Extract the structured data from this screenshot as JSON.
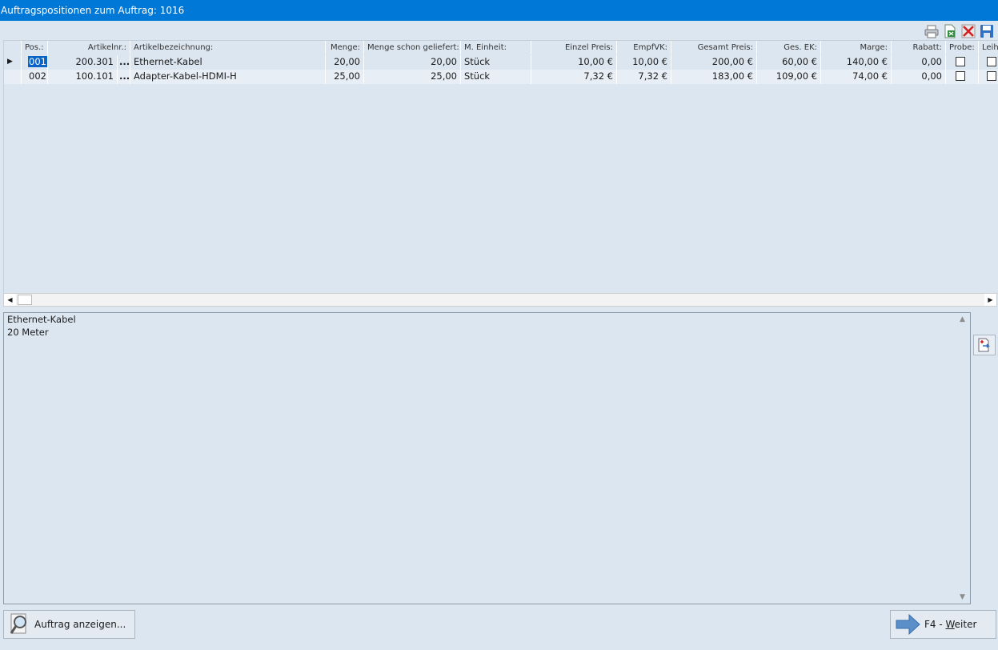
{
  "window": {
    "title": "Auftragspositionen zum Auftrag: 1016"
  },
  "toolbar": [
    {
      "icon": "printer-icon"
    },
    {
      "icon": "excel-export-icon"
    },
    {
      "icon": "delete-icon"
    },
    {
      "icon": "save-icon"
    }
  ],
  "grid": {
    "headers": {
      "pos": "Pos.:",
      "artikelnr": "Artikelnr.:",
      "bezeichnung": "Artikelbezeichnung:",
      "menge": "Menge:",
      "geliefert": "Menge schon geliefert:",
      "einheit": "M. Einheit:",
      "einzelpreis": "Einzel Preis:",
      "empfvk": "EmpfVK:",
      "gesamtpreis": "Gesamt Preis:",
      "gesek": "Ges. EK:",
      "marge": "Marge:",
      "rabatt": "Rabatt:",
      "probe": "Probe:",
      "leih": "Leih"
    },
    "rows": [
      {
        "pos": "001",
        "artikelnr": "200.301",
        "dots": "...",
        "bezeichnung": "Ethernet-Kabel",
        "menge": "20,00",
        "geliefert": "20,00",
        "einheit": "Stück",
        "einzelpreis": "10,00 €",
        "empfvk": "10,00 €",
        "gesamtpreis": "200,00 €",
        "gesek": "60,00 €",
        "marge": "140,00 €",
        "rabatt": "0,00"
      },
      {
        "pos": "002",
        "artikelnr": "100.101",
        "dots": "...",
        "bezeichnung": "Adapter-Kabel-HDMI-H",
        "menge": "25,00",
        "geliefert": "25,00",
        "einheit": "Stück",
        "einzelpreis": "7,32 €",
        "empfvk": "7,32 €",
        "gesamtpreis": "183,00 €",
        "gesek": "109,00 €",
        "marge": "74,00 €",
        "rabatt": "0,00"
      }
    ]
  },
  "memo": {
    "text": "Ethernet-Kabel\n20 Meter"
  },
  "buttons": {
    "show_order": "Auftrag anzeigen...",
    "next_prefix": "F4 - ",
    "next_underlined": "W",
    "next_rest": "eiter"
  },
  "colors": {
    "titlebar": "#0078d7",
    "background": "#dce6f0",
    "selection": "#0a64c8"
  }
}
